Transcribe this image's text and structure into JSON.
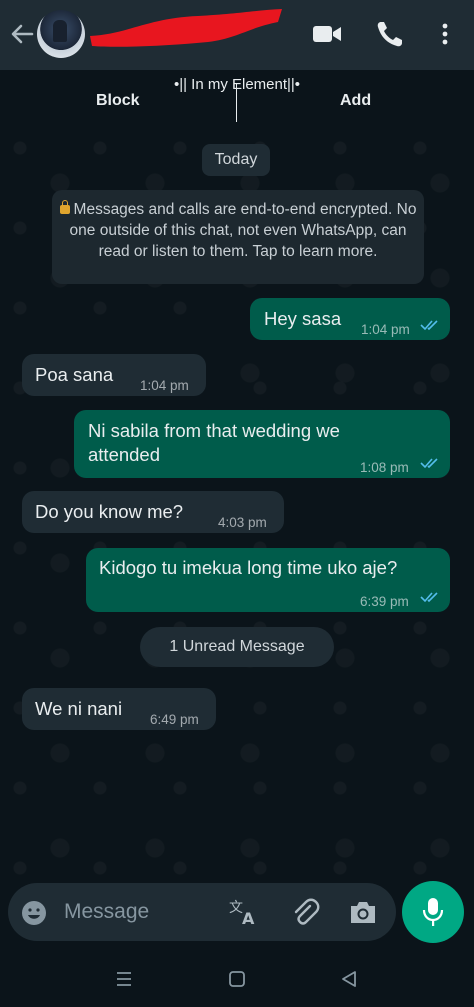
{
  "header": {
    "back_icon": "arrow-left-icon",
    "video_icon": "video-camera-icon",
    "call_icon": "phone-icon",
    "menu_icon": "more-vertical-icon"
  },
  "subheader": {
    "title": "•|| In my Element||•",
    "block_label": "Block",
    "add_label": "Add"
  },
  "chat": {
    "date_chip": "Today",
    "encryption_notice": "Messages and calls are end-to-end encrypted. No one outside of this chat, not even WhatsApp, can read or listen to them. Tap to learn more.",
    "unread_chip": "1 Unread Message",
    "messages": [
      {
        "dir": "out",
        "lines": [
          "Hey sasa"
        ],
        "time": "1:04 pm",
        "read": true
      },
      {
        "dir": "in",
        "lines": [
          "Poa sana"
        ],
        "time": "1:04 pm"
      },
      {
        "dir": "out",
        "lines": [
          "Ni sabila from that wedding we",
          "attended"
        ],
        "time": "1:08 pm",
        "read": true
      },
      {
        "dir": "in",
        "lines": [
          "Do you know me?"
        ],
        "time": "4:03 pm"
      },
      {
        "dir": "out",
        "lines": [
          "Kidogo tu imekua long time uko aje?"
        ],
        "time": "6:39 pm",
        "read": true
      },
      {
        "dir": "in",
        "lines": [
          "We ni nani"
        ],
        "time": "6:49 pm"
      }
    ]
  },
  "composer": {
    "placeholder": "Message",
    "emoji_icon": "emoji-icon",
    "translate_icon": "translate-icon",
    "attach_icon": "paperclip-icon",
    "camera_icon": "camera-icon",
    "mic_icon": "microphone-icon"
  },
  "navbar": {
    "recents_icon": "recents-icon",
    "home_icon": "home-icon",
    "back_icon": "nav-back-icon"
  },
  "colors": {
    "header_bg": "#1f2c34",
    "chat_bg": "#0b141a",
    "outgoing_bubble": "#005c4b",
    "incoming_bubble": "#1f2c34",
    "accent": "#00a884",
    "read_ticks": "#53bdeb",
    "redaction": "#e8161f"
  }
}
